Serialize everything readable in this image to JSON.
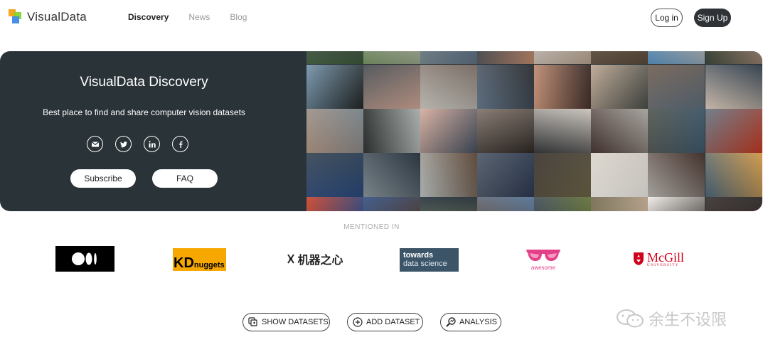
{
  "nav": {
    "brand": "VisualData",
    "links": [
      {
        "label": "Discovery",
        "active": true
      },
      {
        "label": "News",
        "active": false
      },
      {
        "label": "Blog",
        "active": false
      }
    ],
    "login_label": "Log in",
    "signup_label": "Sign Up"
  },
  "hero": {
    "title": "VisualData Discovery",
    "subtitle": "Best place to find and share computer vision datasets",
    "social_icons": [
      "email-icon",
      "twitter-icon",
      "linkedin-icon",
      "facebook-icon"
    ],
    "subscribe_label": "Subscribe",
    "faq_label": "FAQ",
    "mosaic_colors": [
      [
        "#3d5a3a",
        "#6e8b5a",
        "#6d7e86",
        "#2d3a44",
        "#c9c9c9",
        "#5a4b3a",
        "#4c88b8",
        "#2f3b2c",
        "#6d8ea6",
        "#3e4448",
        "#c7c4bd",
        "#5b6f84",
        "#c48c70",
        "#b9a38e",
        "#6a574a",
        "#d8c7b7",
        "#a88c7a",
        "#222625",
        "#d4a998",
        "#7a6d64",
        "#2a2c2f",
        "#3b2a26",
        "#4a4e48",
        "#5e6f7d",
        "#2c3b4a",
        "#7e8a91",
        "#b3b9b8",
        "#455060",
        "#312a26",
        "#d9d2c9",
        "#b0aca6",
        "#3e5a6e",
        "#c53a22",
        "#2a4a7e",
        "#1e2a36",
        "#5d4533",
        "#2d3a51",
        "#6d6547",
        "#f0ece6",
        "#3a2620",
        "#e1a34a",
        "#264b8c",
        "#5c3b26",
        "#808a56",
        "#5a7aa0",
        "#6b7a3c",
        "#d5b9a2",
        "#2d2927",
        "#2d2828",
        "#4d4d48",
        "#3b5f3e",
        "#8a6b52",
        "#3f4c57",
        "#6c7a94",
        "#292c31",
        "#f2eeec",
        "#707579",
        "#1a1d21",
        "#c8a25c",
        "#6e4c3a",
        "#5a5d60",
        "#374458",
        "#5a5f63",
        "#c94032"
      ]
    ]
  },
  "mentioned": {
    "label": "MENTIONED IN",
    "press": [
      {
        "name": "medium",
        "text": ""
      },
      {
        "name": "kdnuggets",
        "text": "KDnuggets",
        "big": "KD",
        "small": "nuggets"
      },
      {
        "name": "jiqizhixin",
        "text": "机器之心"
      },
      {
        "name": "towards-data-science",
        "line1": "towards",
        "line2": "data science"
      },
      {
        "name": "awesome",
        "text": "awesome"
      },
      {
        "name": "mcgill",
        "line1": "McGill",
        "line2": "UNIVERSITY"
      }
    ]
  },
  "actions": {
    "show_label": "SHOW DATASETS",
    "add_label": "ADD DATASET",
    "analysis_label": "ANALYSIS"
  },
  "watermark": {
    "text": "余生不设限"
  }
}
